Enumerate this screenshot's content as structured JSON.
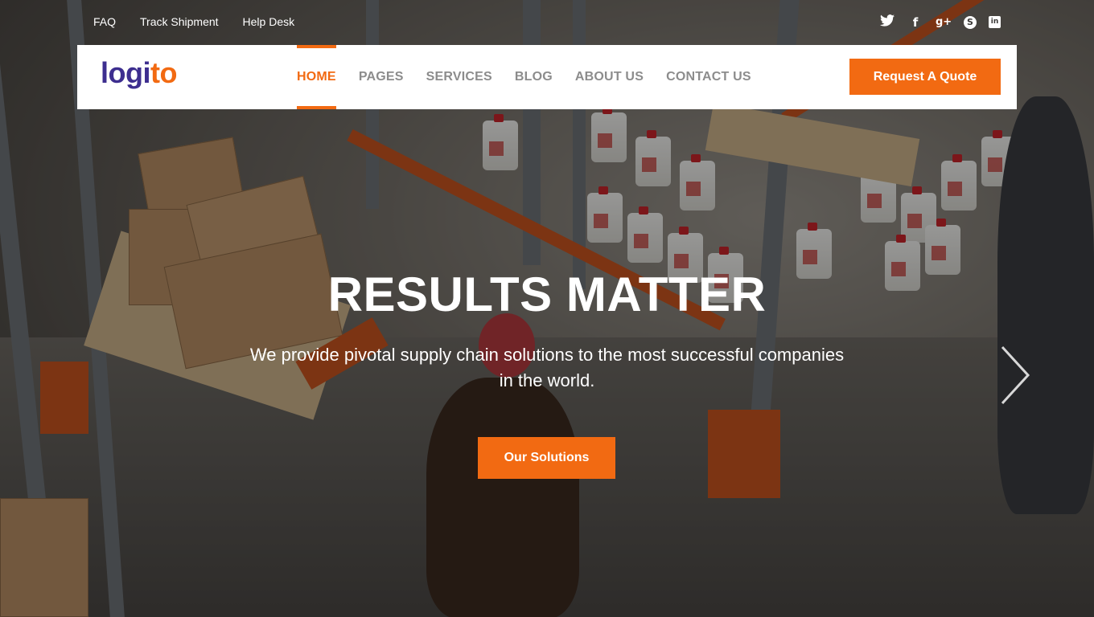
{
  "topbar": {
    "links": [
      "FAQ",
      "Track Shipment",
      "Help Desk"
    ]
  },
  "social": {
    "icons": [
      "twitter-icon",
      "facebook-icon",
      "google-plus-icon",
      "skype-icon",
      "linkedin-icon"
    ],
    "glyphs": {
      "twitter": "🐦",
      "facebook": "f",
      "google_plus": "g+",
      "skype": "S",
      "linkedin": "in"
    }
  },
  "nav": {
    "logo_part1": "logi",
    "logo_part2": "to",
    "items": [
      "HOME",
      "PAGES",
      "SERVICES",
      "BLOG",
      "ABOUT US",
      "CONTACT US"
    ],
    "active": "HOME",
    "quote_label": "Request A Quote"
  },
  "hero": {
    "title": "RESULTS MATTER",
    "subtitle": "We provide pivotal supply chain solutions to the most successful companies in the world.",
    "cta_label": "Our Solutions"
  },
  "colors": {
    "accent": "#f26a12",
    "logo_primary": "#3d2e8f",
    "nav_text": "#8c8c8c"
  }
}
